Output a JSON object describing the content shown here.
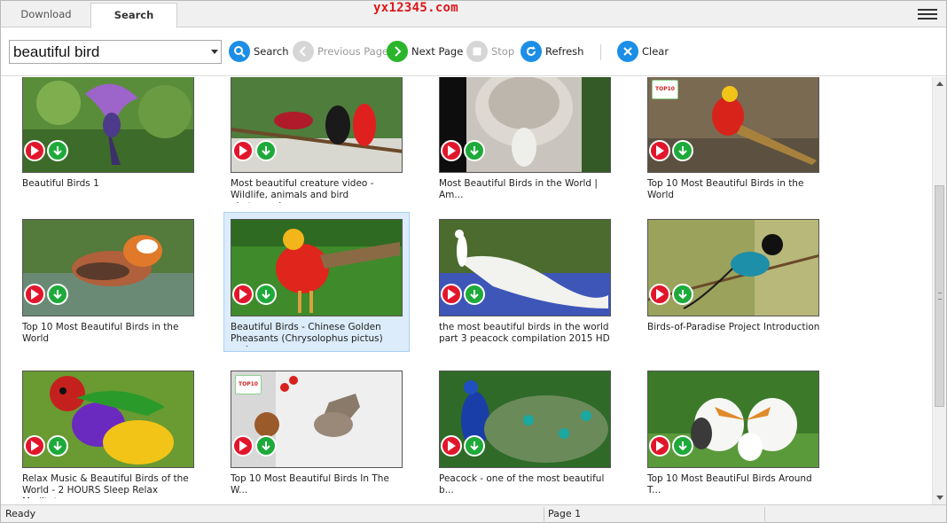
{
  "watermark": "yx12345.com",
  "tabs": {
    "download": "Download",
    "search": "Search"
  },
  "toolbar": {
    "search_value": "beautiful bird",
    "search_label": "Search",
    "previous_label": "Previous Page",
    "next_label": "Next Page",
    "stop_label": "Stop",
    "refresh_label": "Refresh",
    "clear_label": "Clear"
  },
  "results": [
    {
      "title": "Beautiful Birds 1",
      "thumb": "purple-bird"
    },
    {
      "title": "Most beautiful creature video - Wildlife, animals and bird photography",
      "thumb": "red-birds"
    },
    {
      "title": "Most Beautiful Birds in the World | Am...",
      "thumb": "white-peacock-fan"
    },
    {
      "title": "Top 10 Most Beautiful Birds in the World",
      "thumb": "golden-pheasant",
      "badge": "TOP10"
    },
    {
      "title": "Top 10 Most Beautiful Birds in the World",
      "thumb": "mandarin-duck"
    },
    {
      "title": "Beautiful Birds - Chinese Golden Pheasants (Chrysolophus pictus) and...",
      "thumb": "golden-pheasant-grass",
      "selected": true
    },
    {
      "title": "the most beautiful birds in the world part 3   peacock compilation 2015  HD",
      "thumb": "white-peacock"
    },
    {
      "title": "Birds-of-Paradise Project Introduction",
      "thumb": "bird-of-paradise"
    },
    {
      "title": "Relax Music & Beautiful Birds of the World - 2 HOURS Sleep Relax Meditat...",
      "thumb": "gouldian-finch"
    },
    {
      "title": "Top 10 Most Beautiful Birds In The W...",
      "thumb": "waxwing",
      "badge": "TOP10"
    },
    {
      "title": "Peacock - one of the most beautiful b...",
      "thumb": "peacock"
    },
    {
      "title": "Top 10 Most BeautiFul Birds Around T...",
      "thumb": "albatross"
    }
  ],
  "status": {
    "left": "Ready",
    "page": "Page 1"
  },
  "colors": {
    "play": "#e2162b",
    "download": "#1eaa3a",
    "toolbar_blue": "#1c8ee6",
    "next_green": "#2ab52a",
    "selected_bg": "#dcecfb"
  }
}
